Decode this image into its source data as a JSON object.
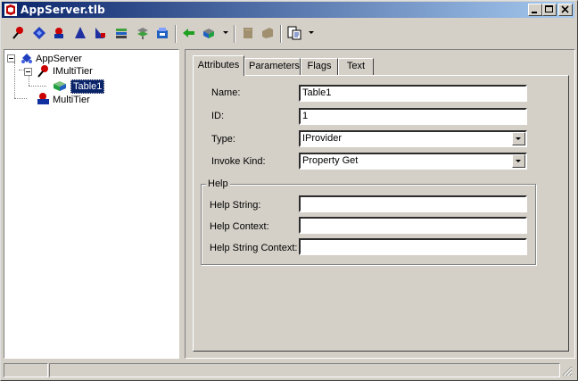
{
  "window": {
    "title": "AppServer.tlb"
  },
  "toolbar": {
    "buttons": [
      {
        "icon": "new-interface-icon"
      },
      {
        "icon": "new-dispinterface-icon"
      },
      {
        "icon": "new-coclass-icon"
      },
      {
        "icon": "new-enum-icon"
      },
      {
        "icon": "new-alias-icon"
      },
      {
        "icon": "new-record-icon"
      },
      {
        "icon": "new-union-icon"
      },
      {
        "icon": "new-module-icon"
      },
      {
        "icon": "new-method-icon"
      },
      {
        "icon": "new-property-icon"
      },
      {
        "icon": "refresh-icon"
      },
      {
        "icon": "register-icon"
      },
      {
        "icon": "export-icon"
      }
    ]
  },
  "tree": {
    "items": [
      {
        "label": "AppServer",
        "icon": "typelib-icon"
      },
      {
        "label": "IMultiTier",
        "icon": "interface-icon"
      },
      {
        "label": "Table1",
        "icon": "property-icon",
        "selected": true
      },
      {
        "label": "MultiTier",
        "icon": "coclass-icon"
      }
    ]
  },
  "tabs": [
    {
      "label": "Attributes",
      "active": true
    },
    {
      "label": "Parameters"
    },
    {
      "label": "Flags"
    },
    {
      "label": "Text"
    }
  ],
  "attributes": {
    "name_label": "Name:",
    "name_value": "Table1",
    "id_label": "ID:",
    "id_value": "1",
    "type_label": "Type:",
    "type_value": "IProvider",
    "invoke_label": "Invoke Kind:",
    "invoke_value": "Property Get"
  },
  "help": {
    "group_label": "Help",
    "help_string_label": "Help String:",
    "help_string_value": "",
    "help_context_label": "Help Context:",
    "help_context_value": "",
    "help_string_context_label": "Help String Context:",
    "help_string_context_value": ""
  },
  "colors": {
    "title_start": "#0a246a",
    "title_end": "#a6caf0",
    "face": "#d4d0c8",
    "selection": "#0a246a"
  }
}
